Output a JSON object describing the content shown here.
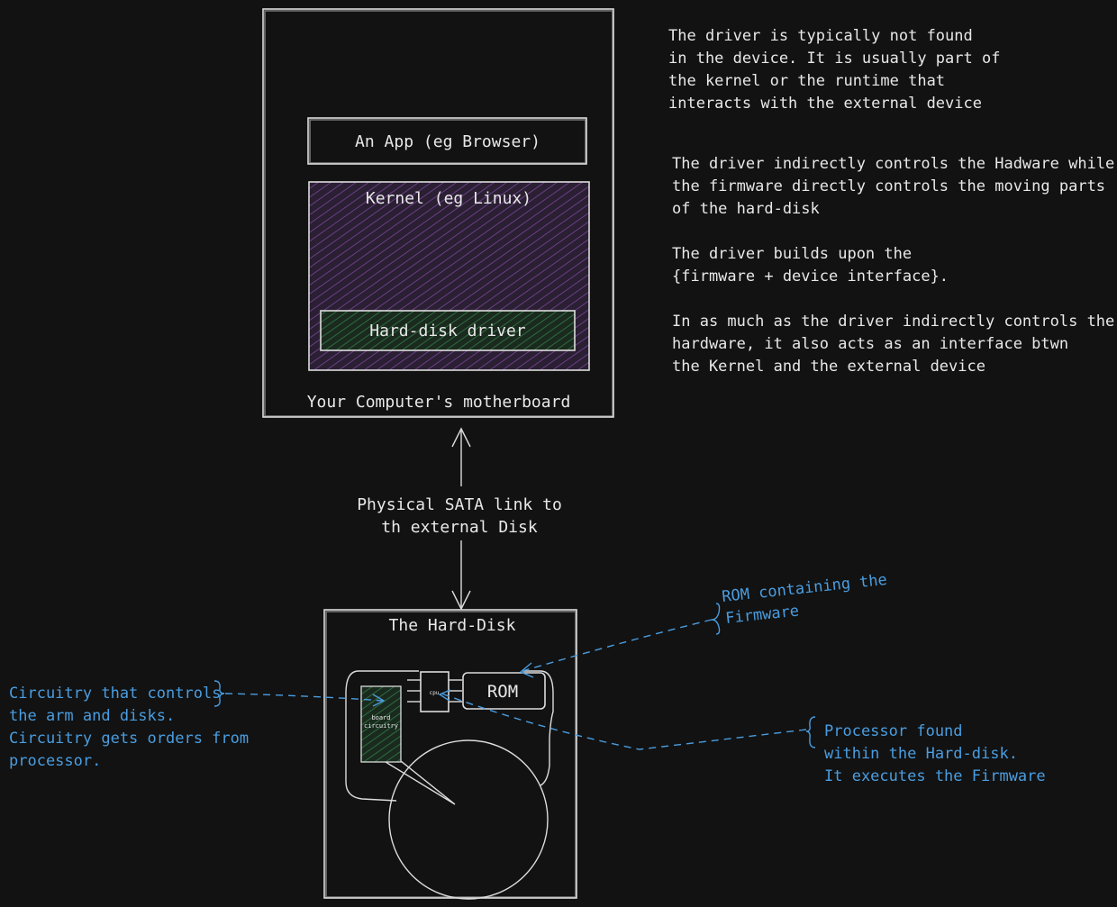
{
  "motherboard": {
    "caption": "Your Computer's motherboard",
    "app_label": "An App (eg Browser)",
    "kernel_label": "Kernel (eg Linux)",
    "driver_label": "Hard-disk driver"
  },
  "link": {
    "line1": "Physical SATA link to",
    "line2": "th external Disk"
  },
  "harddisk": {
    "title": "The Hard-Disk",
    "rom_label": "ROM",
    "cpu_label": "cpu",
    "board_label_1": "board",
    "board_label_2": "circuitry"
  },
  "notes": {
    "note1": [
      "The driver is typically not found",
      "in the device. It is usually part of",
      "the kernel or the runtime that",
      "interacts with the external device"
    ],
    "note2": [
      "The driver indirectly controls the Hadware while",
      "the firmware directly controls the moving parts",
      "of the hard-disk"
    ],
    "note3": [
      "The driver builds upon the",
      "{firmware + device interface}."
    ],
    "note4": [
      "In as much as the driver indirectly controls the",
      "hardware, it also acts as an interface btwn",
      "the Kernel and the external device"
    ]
  },
  "annotations": {
    "rom": [
      "ROM containing the",
      "Firmware"
    ],
    "processor": [
      "Processor found",
      "within the Hard-disk.",
      "It executes the Firmware"
    ],
    "circuitry": [
      "Circuitry that controls",
      "the arm and disks.",
      "Circuitry gets orders from",
      "processor."
    ]
  },
  "colors": {
    "background": "#121212",
    "stroke": "#dcdcdc",
    "annotation": "#4a9de0",
    "kernel_fill": "#3a2447",
    "driver_fill": "#1e3a25",
    "board_fill": "#1e3a25"
  }
}
